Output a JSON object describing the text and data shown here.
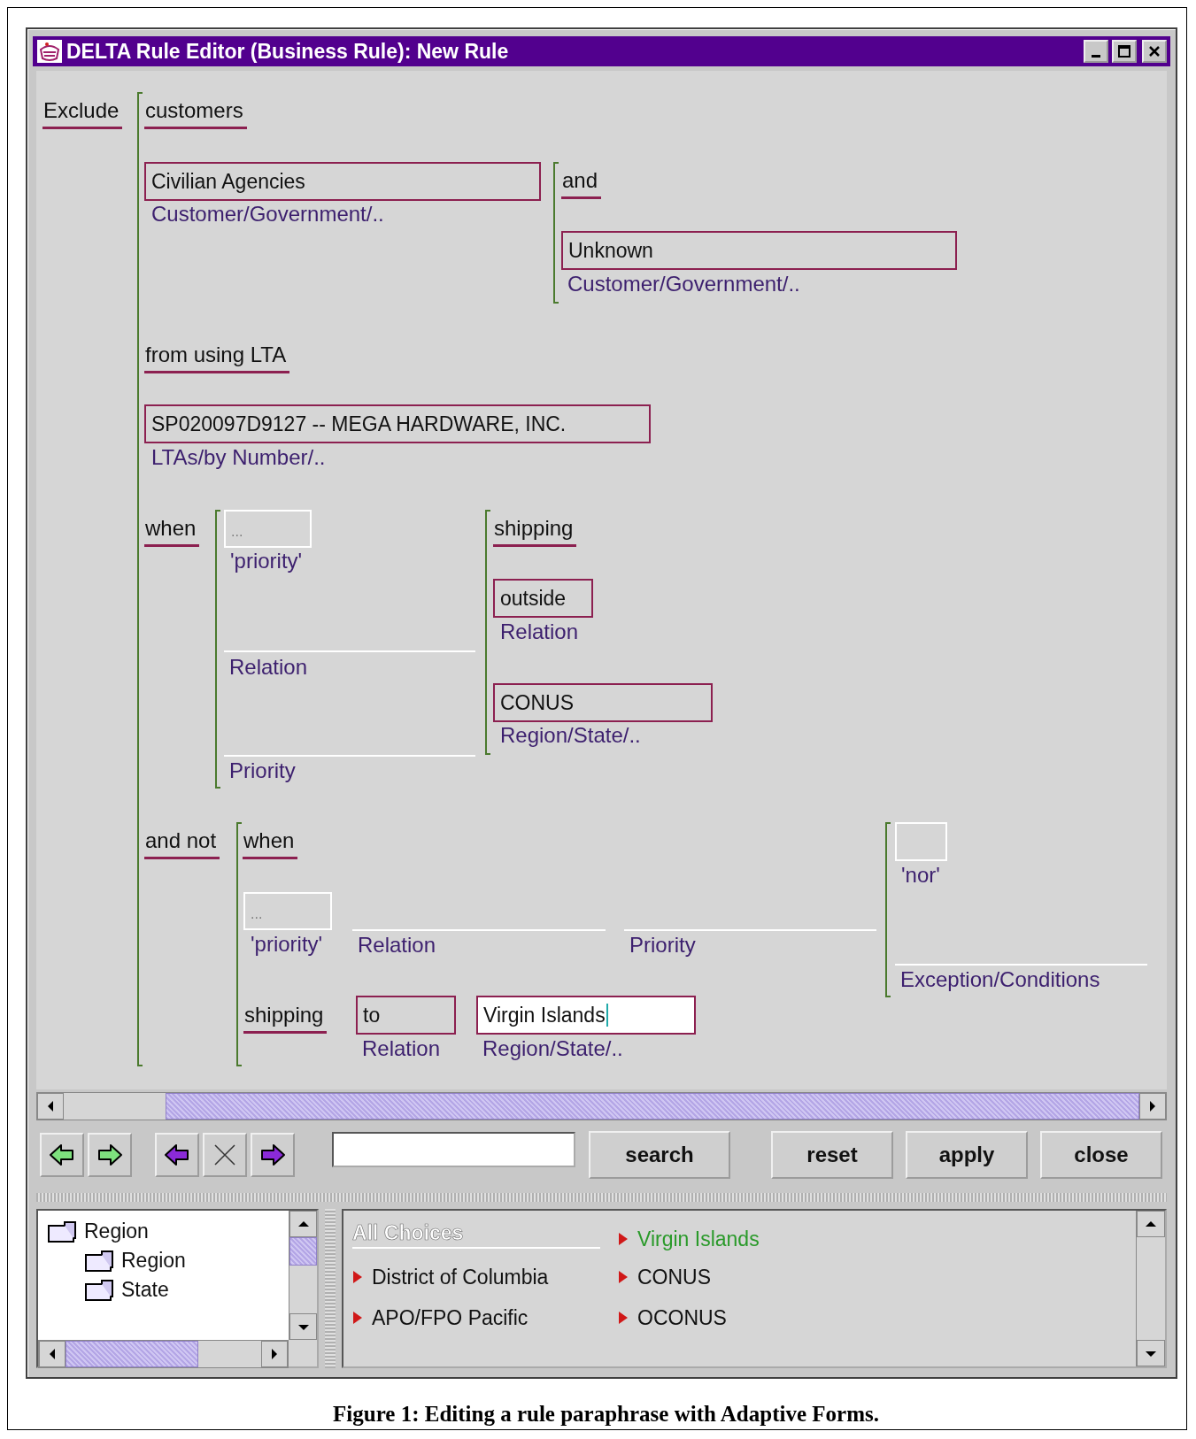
{
  "window": {
    "title": "DELTA Rule Editor (Business Rule): New Rule"
  },
  "paraphrase": {
    "items": [
      {
        "kind": "keyword",
        "text": "Exclude"
      },
      {
        "kind": "keyword",
        "text": "customers"
      },
      {
        "kind": "slot",
        "value": "Civilian Agencies",
        "caption": "Customer/Government/.."
      },
      {
        "kind": "keyword",
        "text": "and"
      },
      {
        "kind": "slot",
        "value": "Unknown",
        "caption": "Customer/Government/.."
      },
      {
        "kind": "keyword",
        "text": "from using LTA"
      },
      {
        "kind": "slot",
        "value": "SP020097D9127 -- MEGA HARDWARE, INC.",
        "caption": "LTAs/by Number/.."
      },
      {
        "kind": "keyword",
        "text": "when"
      },
      {
        "kind": "empty",
        "placeholder": "...",
        "caption": "'priority'"
      },
      {
        "kind": "blank",
        "caption": "Relation"
      },
      {
        "kind": "blank",
        "caption": "Priority"
      },
      {
        "kind": "keyword",
        "text": "shipping"
      },
      {
        "kind": "slot",
        "value": "outside",
        "caption": "Relation"
      },
      {
        "kind": "slot",
        "value": "CONUS",
        "caption": "Region/State/.."
      },
      {
        "kind": "keyword",
        "text": "and not"
      },
      {
        "kind": "keyword",
        "text": "when"
      },
      {
        "kind": "empty",
        "caption": "'nor'"
      },
      {
        "kind": "empty",
        "placeholder": "...",
        "caption": "'priority'"
      },
      {
        "kind": "blank",
        "caption": "Relation"
      },
      {
        "kind": "blank",
        "caption": "Priority"
      },
      {
        "kind": "blank",
        "caption": "Exception/Conditions"
      },
      {
        "kind": "keyword",
        "text": "shipping"
      },
      {
        "kind": "slot",
        "value": "to",
        "caption": "Relation"
      },
      {
        "kind": "input",
        "value": "Virgin Islands",
        "caption": "Region/State/.."
      }
    ]
  },
  "toolbar": {
    "buttons": [
      "search",
      "reset",
      "apply",
      "close"
    ]
  },
  "tree": [
    {
      "label": "Region",
      "children": [
        {
          "label": "Region"
        },
        {
          "label": "State"
        }
      ]
    }
  ],
  "choices": {
    "header": "All Choices",
    "items": [
      {
        "text": "District of Columbia",
        "selected": false
      },
      {
        "text": "APO/FPO Pacific",
        "selected": false
      },
      {
        "text": "Virgin Islands",
        "selected": true
      },
      {
        "text": "CONUS",
        "selected": false
      },
      {
        "text": "OCONUS",
        "selected": false
      }
    ]
  },
  "caption": "Figure 1: Editing a rule paraphrase with Adaptive Forms."
}
